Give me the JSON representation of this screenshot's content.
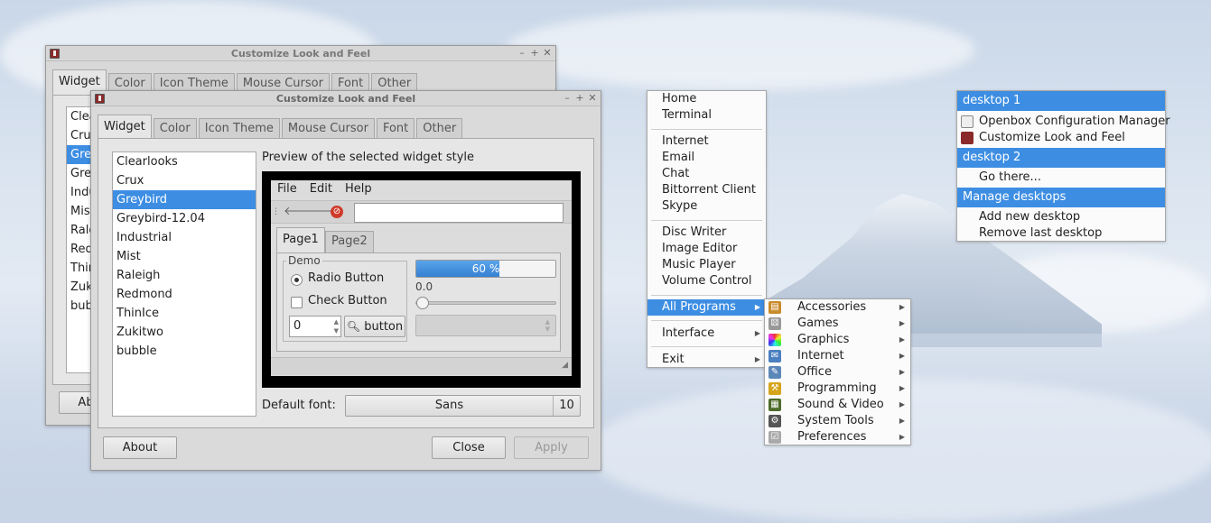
{
  "back_window": {
    "title": "Customize Look and Feel",
    "tabs": [
      "Widget",
      "Color",
      "Icon Theme",
      "Mouse Cursor",
      "Font",
      "Other"
    ],
    "list": [
      "Clea",
      "Cru",
      "Grey",
      "Gre",
      "Indu",
      "Mist",
      "Rale",
      "Red",
      "Thir",
      "Zuk",
      "bub"
    ],
    "about_label": "Ab"
  },
  "front_window": {
    "title": "Customize Look and Feel",
    "tabs": [
      "Widget",
      "Color",
      "Icon Theme",
      "Mouse Cursor",
      "Font",
      "Other"
    ],
    "themes": [
      "Clearlooks",
      "Crux",
      "Greybird",
      "Greybird-12.04",
      "Industrial",
      "Mist",
      "Raleigh",
      "Redmond",
      "ThinIce",
      "Zukitwo",
      "bubble"
    ],
    "selected_theme": "Greybird",
    "preview_label": "Preview of the selected widget style",
    "preview": {
      "menus": [
        "File",
        "Edit",
        "Help"
      ],
      "tabs": [
        "Page1",
        "Page2"
      ],
      "frame_label": "Demo",
      "radio_label": "Radio Button",
      "check_label": "Check Button",
      "spin_value": "0",
      "button_label": "button",
      "progress_text": "60 %",
      "progress_value": 0.6,
      "scale_value": "0.0"
    },
    "font_label": "Default font:",
    "font_name": "Sans",
    "font_size": "10",
    "about_label": "About",
    "close_label": "Close",
    "apply_label": "Apply"
  },
  "root_menu": {
    "items": {
      "home": "Home",
      "terminal": "Terminal",
      "internet": "Internet",
      "email": "Email",
      "chat": "Chat",
      "bittorrent": "Bittorrent Client",
      "skype": "Skype",
      "disc_writer": "Disc Writer",
      "image_editor": "Image Editor",
      "music_player": "Music Player",
      "volume_control": "Volume Control",
      "all_programs": "All Programs",
      "interface": "Interface",
      "exit": "Exit"
    }
  },
  "programs_menu": {
    "items": [
      "Accessories",
      "Games",
      "Graphics",
      "Internet",
      "Office",
      "Programming",
      "Sound & Video",
      "System Tools",
      "Preferences"
    ]
  },
  "desktop_menu": {
    "desktop1": "desktop 1",
    "d1_items": [
      "Openbox Configuration Manager",
      "Customize Look and Feel"
    ],
    "desktop2": "desktop 2",
    "go_there": "Go there...",
    "manage": "Manage desktops",
    "add": "Add new desktop",
    "remove": "Remove last desktop"
  },
  "colors": {
    "accent": "#3d8ee3"
  }
}
